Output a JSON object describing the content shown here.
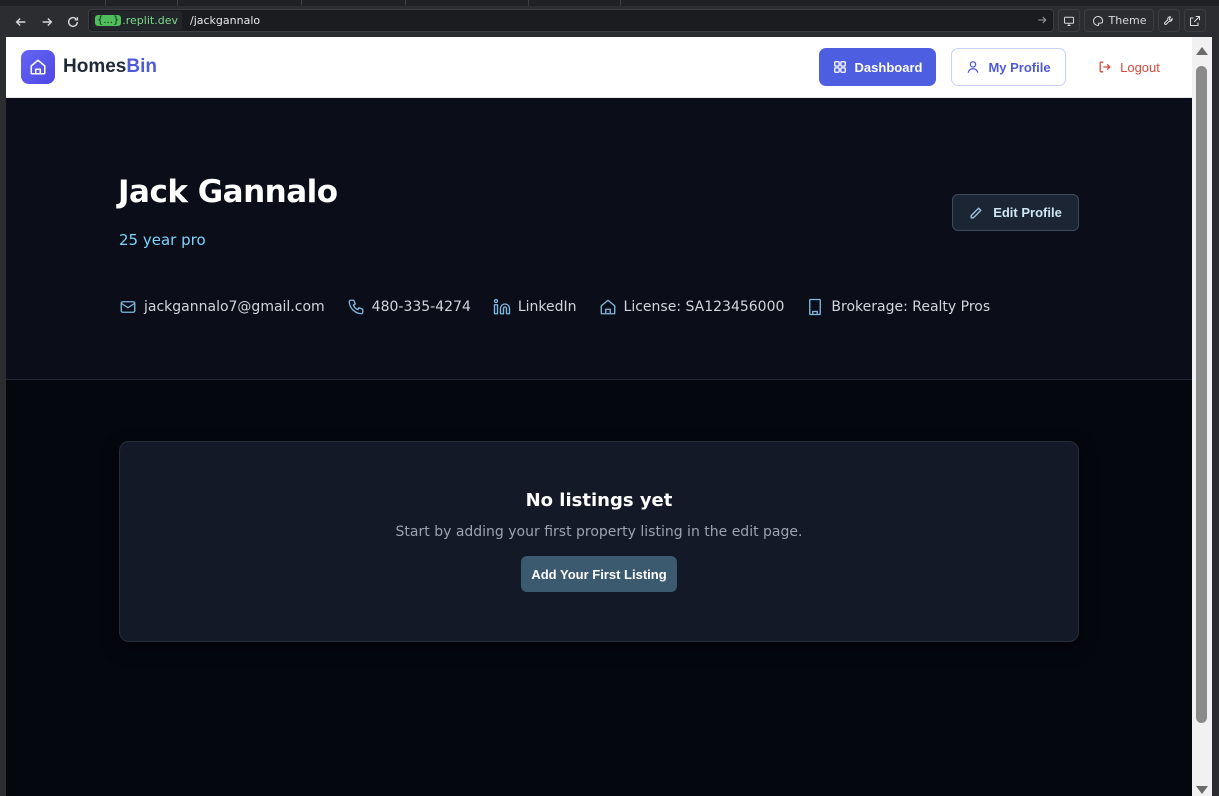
{
  "browser": {
    "url_host_badge": "{...}",
    "url_host": ".replit.dev",
    "url_path": "/jackgannalo",
    "theme_label": "Theme"
  },
  "navbar": {
    "brand_part1": "Homes",
    "brand_part2": "Bin",
    "dashboard_label": "Dashboard",
    "my_profile_label": "My Profile",
    "logout_label": "Logout"
  },
  "profile": {
    "name": "Jack Gannalo",
    "tagline": "25 year pro",
    "edit_label": "Edit Profile",
    "contacts": [
      {
        "icon": "mail-icon",
        "text": "jackgannalo7@gmail.com"
      },
      {
        "icon": "phone-icon",
        "text": "480-335-4274"
      },
      {
        "icon": "linkedin-icon",
        "text": "LinkedIn"
      },
      {
        "icon": "home-icon",
        "text": "License: SA123456000"
      },
      {
        "icon": "building-icon",
        "text": "Brokerage: Realty Pros"
      }
    ]
  },
  "listings": {
    "empty_title": "No listings yet",
    "empty_subtitle": "Start by adding your first property listing in the edit page.",
    "add_label": "Add Your First Listing"
  },
  "colors": {
    "primary": "#4e5ee0",
    "tagline": "#7dd3fc",
    "logout": "#d94a3a",
    "hero_bg": "#0b0e18",
    "page_bg": "#05070f"
  }
}
